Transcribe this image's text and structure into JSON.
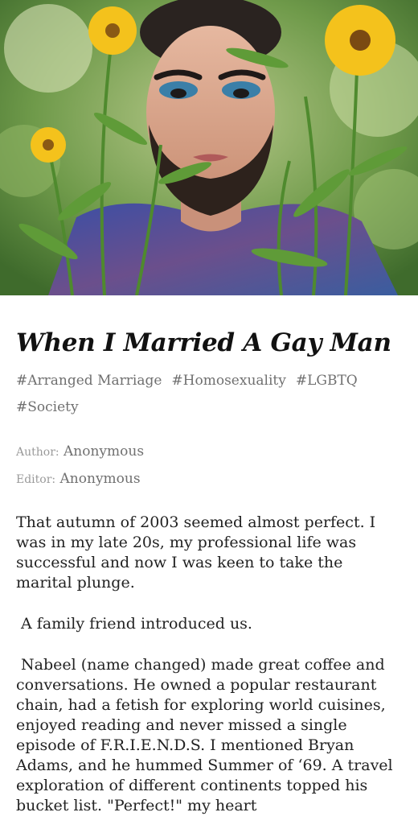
{
  "hero": {
    "image_alt": "Bearded man with blue eyeshadow among yellow flowers"
  },
  "article": {
    "title": "When I Married A Gay Man",
    "tags": [
      "#Arranged Marriage",
      "#Homosexuality",
      "#LGBTQ",
      "#Society"
    ],
    "author_label": "Author:",
    "author": "Anonymous",
    "editor_label": "Editor:",
    "editor": "Anonymous",
    "paragraphs": [
      "That autumn of 2003 seemed almost perfect. I was in my late 20s, my professional life was successful and now I was keen to take the marital plunge.",
      " A family friend introduced us.",
      " Nabeel (name changed) made great coffee and conversations. He owned a popular restaurant chain, had a fetish for exploring world cuisines, enjoyed reading and never missed a single episode of F.R.I.E.N.D.S. I mentioned Bryan Adams, and he hummed Summer of ‘69. A travel exploration of different continents topped his bucket list. \"Perfect!\" my heart"
    ]
  },
  "colors": {
    "title": "#111111",
    "meta": "#707070",
    "body": "#222222",
    "flower": "#f4c21c",
    "leaf": "#4f8a2e"
  }
}
